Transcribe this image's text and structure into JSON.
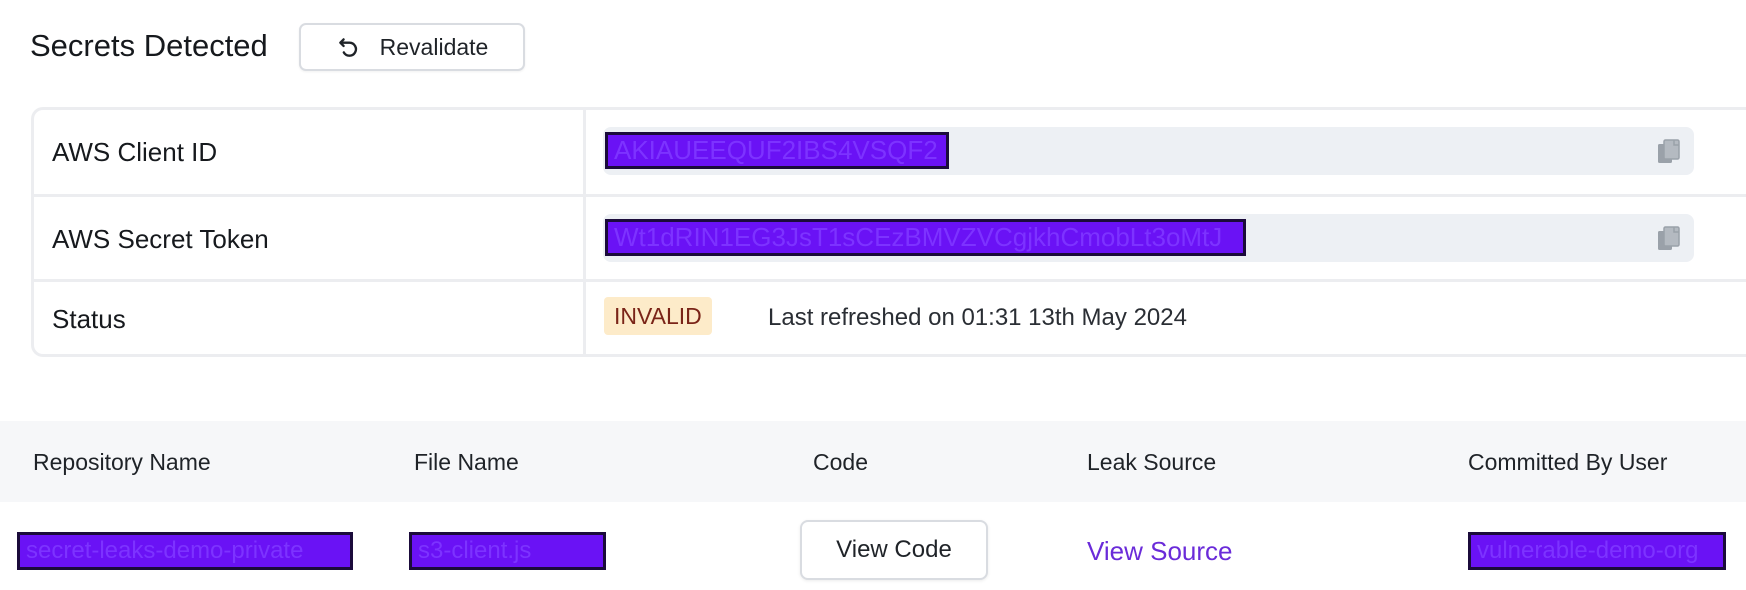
{
  "header": {
    "title": "Secrets Detected",
    "revalidate_label": "Revalidate",
    "revalidate_icon": "refresh-icon"
  },
  "details": {
    "client_id_label": "AWS Client ID",
    "client_id_value": "AKIAUEEQUF2IBS4VSQF2",
    "secret_token_label": "AWS Secret Token",
    "secret_token_value": "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",
    "copy_icon": "copy-icon",
    "status_label": "Status",
    "status_badge": "INVALID",
    "status_text": "Last refreshed on 01:31 13th May 2024"
  },
  "table": {
    "columns": [
      "Repository Name",
      "File Name",
      "Code",
      "Leak Source",
      "Committed By User"
    ],
    "rows": [
      {
        "repository": "secret-leaks-demo-private",
        "file": "s3-client.js",
        "code_label": "View Code",
        "leak_source_label": "View Source",
        "committed_by": "vulnerable-demo-org"
      }
    ]
  },
  "colors": {
    "redaction": "#6a12f5",
    "badge_bg": "#fdebc9",
    "badge_text": "#7a2418",
    "link": "#6a2bd9"
  }
}
